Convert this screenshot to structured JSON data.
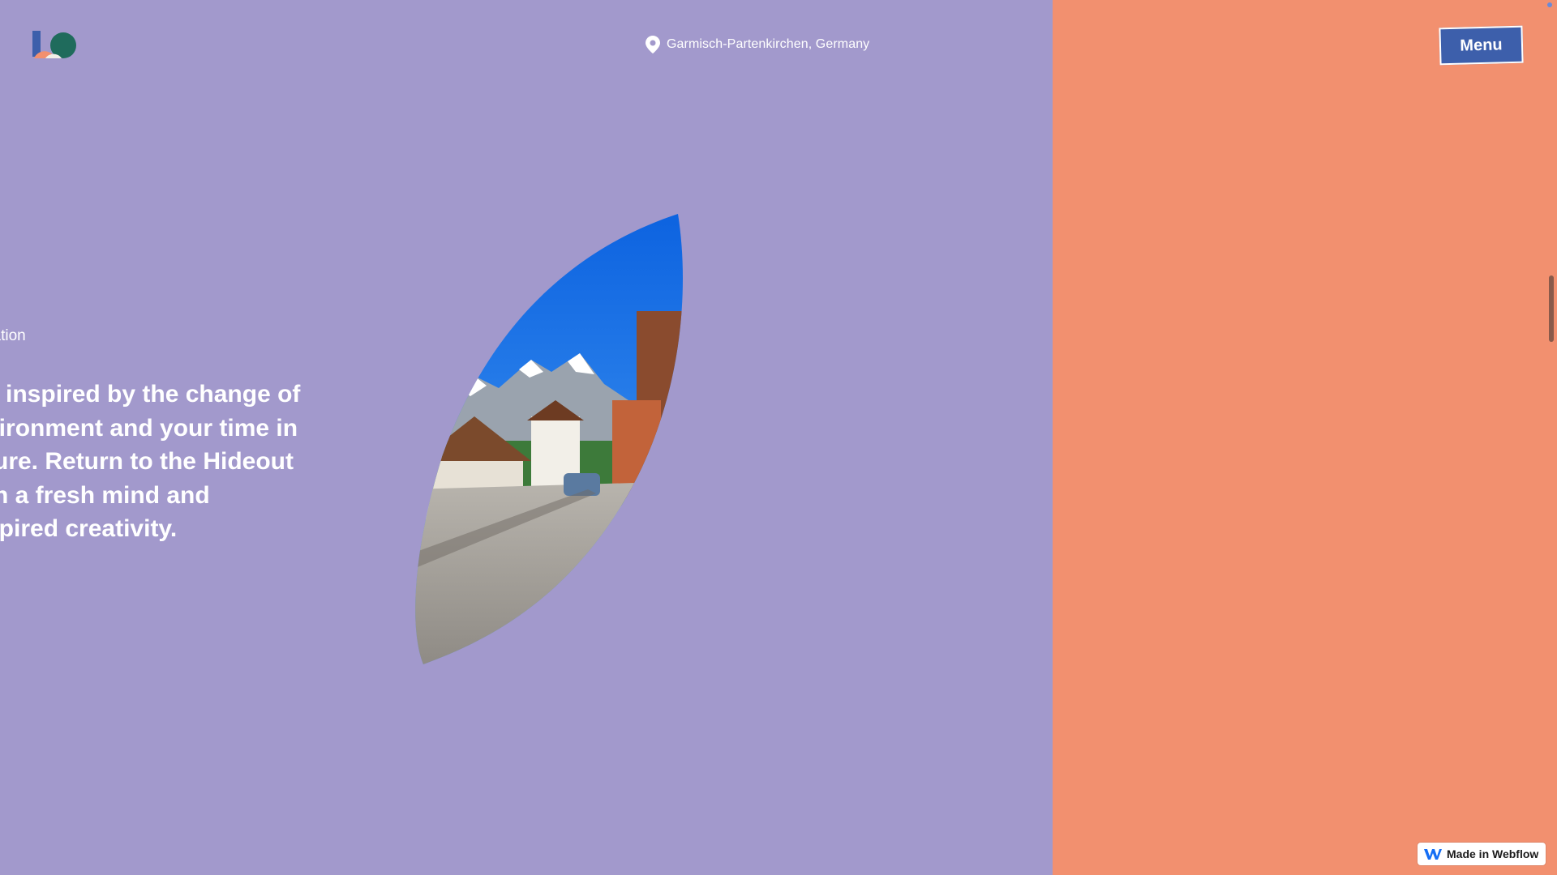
{
  "colors": {
    "left_panel_bg": "#a299cc",
    "right_panel_bg": "#f2906f",
    "menu_button_bg": "#3d5fab",
    "webflow_blue": "#146ef5"
  },
  "header": {
    "logo_icon": "brand-logo-icon",
    "location_icon": "map-pin-icon",
    "location": "Garmisch-Partenkirchen, Germany",
    "menu_label": "Menu"
  },
  "main": {
    "section_label": "iration",
    "headline": "e inspired by the change of vironment and your time in ture. Return to the Hideout th a fresh mind and spired creativity.",
    "headline_lines": [
      "e inspired by the change of",
      "vironment and your time in",
      "ture. Return to the Hideout",
      "th a fresh mind and",
      "spired creativity."
    ],
    "image_subject": "alpine village street with mountains"
  },
  "badge": {
    "icon": "webflow-logo-icon",
    "label": "Made in Webflow"
  }
}
